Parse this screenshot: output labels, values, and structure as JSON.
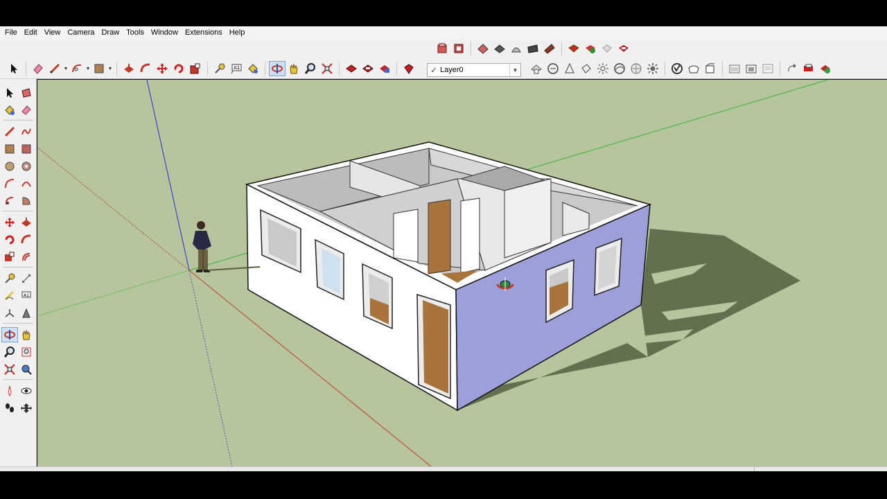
{
  "menu": [
    "File",
    "Edit",
    "View",
    "Camera",
    "Draw",
    "Tools",
    "Window",
    "Extensions",
    "Help"
  ],
  "layers": {
    "current": "Layer0",
    "check": "✓"
  },
  "colors": {
    "sky_ground": "#b6c59c",
    "axis_red": "#c0392b",
    "axis_green": "#2eb82e",
    "axis_blue": "#2a2ad8",
    "wall_white": "#ffffff",
    "wall_selected": "#9d9fd8",
    "wood": "#a9743c",
    "shadow": "#62704f"
  },
  "icons": {
    "toolbar_row1": [
      "component-icon",
      "component-save-icon",
      "section-plane-icon",
      "section-display-icon",
      "section-cut-icon",
      "box-icon",
      "texture-icon",
      "warehouse-icon",
      "model-info-icon",
      "extension-icon",
      "share-icon",
      "ruby-icon"
    ],
    "toolbar_row2": [
      "select-icon",
      "eraser-icon",
      "pencil-icon",
      "arc-icon",
      "rectangle-icon",
      "push-pull-icon",
      "follow-me-icon",
      "move-icon",
      "rotate-icon",
      "scale-icon",
      "tape-measure-icon",
      "text-icon",
      "paint-bucket-icon",
      "orbit-icon",
      "pan-icon",
      "zoom-icon",
      "zoom-extents-icon",
      "warehouse-get-icon",
      "warehouse-share-icon",
      "component-share-icon",
      "ruby-console-icon"
    ],
    "styles": [
      "xray-icon",
      "back-edges-icon",
      "wireframe-icon",
      "hidden-line-icon",
      "shaded-icon",
      "textures-icon",
      "monochrome-icon",
      "shadows-icon"
    ],
    "views": [
      "iso-icon",
      "top-icon",
      "front-icon",
      "camera-icon"
    ]
  },
  "scene": {
    "figure": "person-figure",
    "model": "house-model"
  }
}
